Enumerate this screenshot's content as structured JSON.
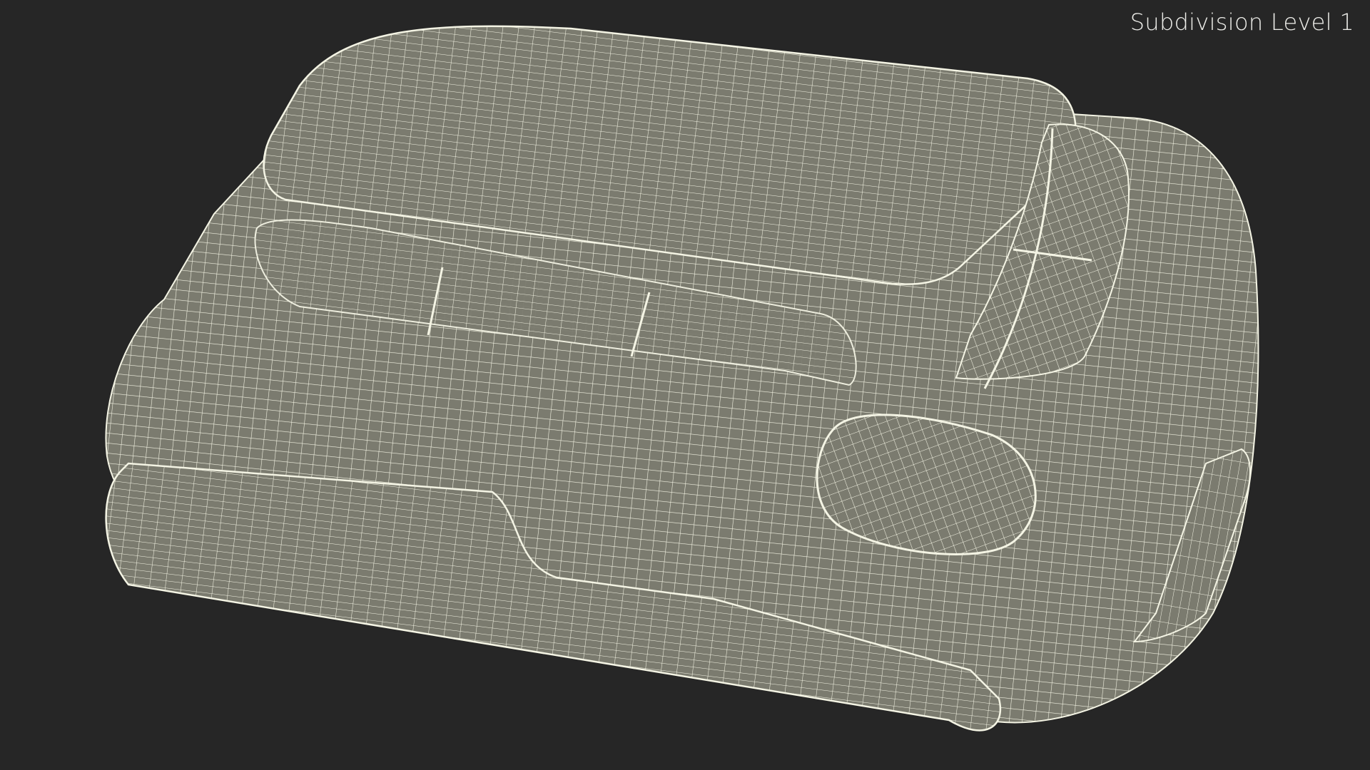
{
  "viewport": {
    "label": "Subdivision Level 1",
    "background_color": "#262626",
    "model_fill_color": "#7b7b6f",
    "wire_color": "#f4f4e4"
  }
}
